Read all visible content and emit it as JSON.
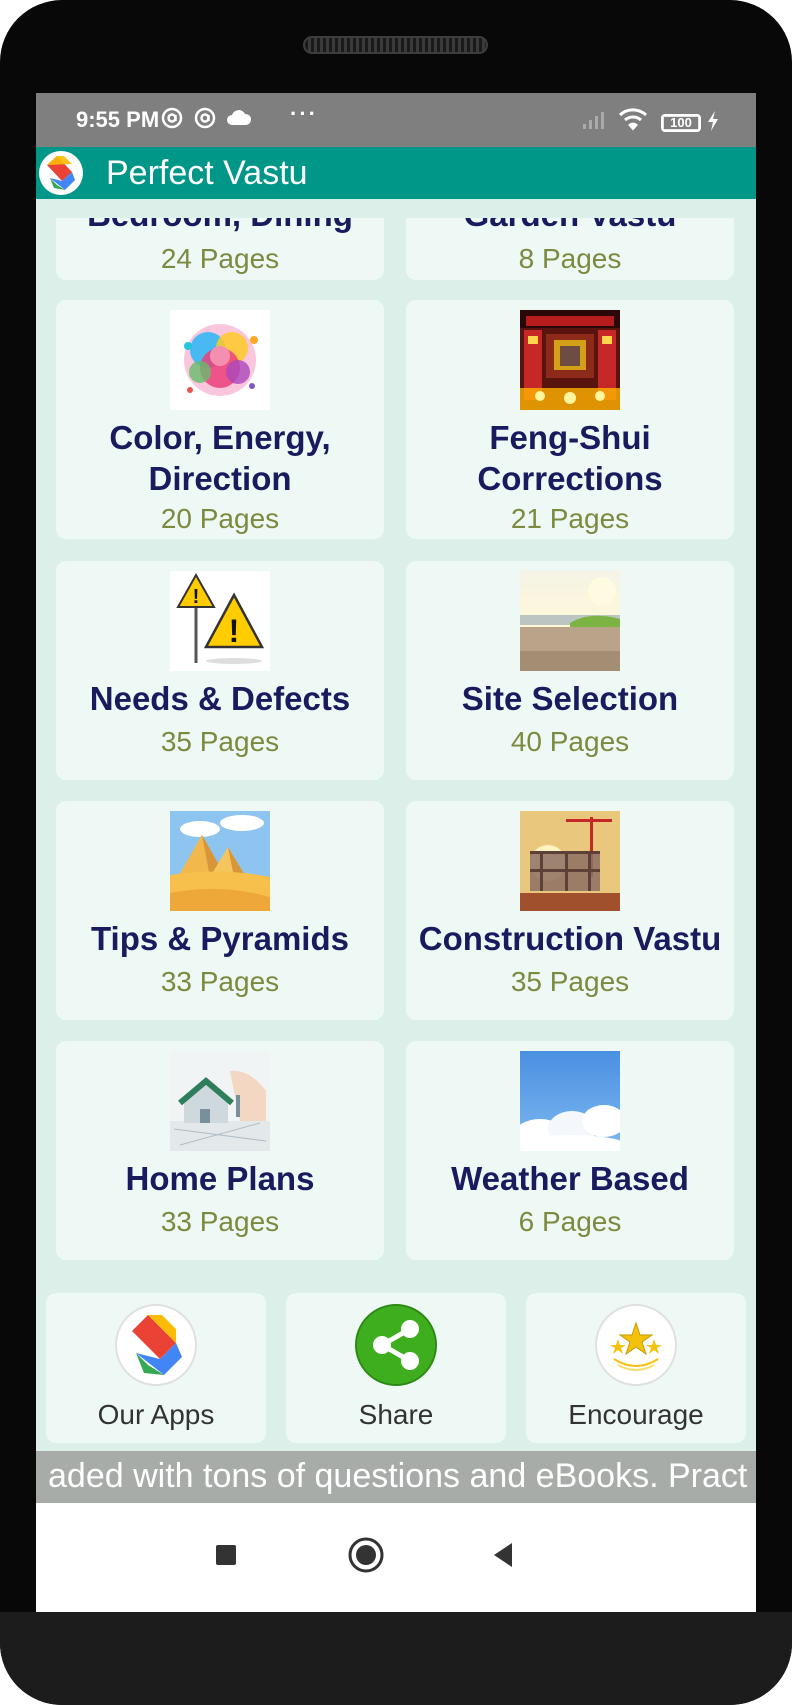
{
  "status_bar": {
    "time": "9:55 PM",
    "more": "···",
    "battery": "100",
    "icons": [
      "at-sign-icon",
      "at-sign-icon",
      "cloud-icon",
      "signal-icon",
      "wifi-icon",
      "battery-icon",
      "charging-icon"
    ]
  },
  "app_bar": {
    "title": "Perfect Vastu",
    "logo_icon": "app-logo-icon"
  },
  "categories": [
    {
      "title": "Bedroom, Dining",
      "pages": "24 Pages"
    },
    {
      "title": "Garden Vastu",
      "pages": "8 Pages"
    },
    {
      "title": "Color, Energy, Direction",
      "title_line1": "Color, Energy,",
      "title_line2": "Direction",
      "pages": "20 Pages",
      "image": "color-powder-explosion-image"
    },
    {
      "title": "Feng-Shui Corrections",
      "title_line1": "Feng-Shui",
      "title_line2": "Corrections",
      "pages": "21 Pages",
      "image": "chinese-temple-image"
    },
    {
      "title": "Needs & Defects",
      "pages": "35 Pages",
      "image": "warning-signs-image"
    },
    {
      "title": "Site Selection",
      "pages": "40 Pages",
      "image": "empty-land-image"
    },
    {
      "title": "Tips & Pyramids",
      "pages": "33 Pages",
      "image": "pyramids-desert-image"
    },
    {
      "title": "Construction Vastu",
      "pages": "35 Pages",
      "image": "construction-site-image"
    },
    {
      "title": "Home Plans",
      "pages": "33 Pages",
      "image": "house-model-image"
    },
    {
      "title": "Weather Based",
      "pages": "6 Pages",
      "image": "clouds-sky-image"
    }
  ],
  "bottom_actions": [
    {
      "label": "Our Apps",
      "icon": "app-logo-icon"
    },
    {
      "label": "Share",
      "icon": "share-icon"
    },
    {
      "label": "Encourage",
      "icon": "stars-icon"
    }
  ],
  "marquee": {
    "text": "aded with tons of questions and eBooks. Pract"
  },
  "navigation": {
    "recents_icon": "square-icon",
    "home_icon": "circle-icon",
    "back_icon": "triangle-back-icon"
  },
  "colors": {
    "app_bar": "#009688",
    "title_text": "#1a1a5e",
    "pages_text": "#7b8a3e",
    "background": "#dcefe9"
  }
}
